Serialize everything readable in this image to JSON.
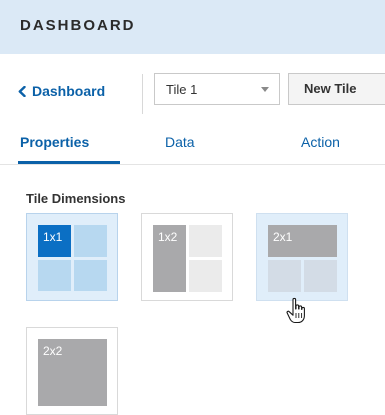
{
  "header": {
    "title": "DASHBOARD"
  },
  "nav": {
    "back_label": "Dashboard",
    "tile_select_value": "Tile 1",
    "new_tile_label": "New Tile"
  },
  "tabs": [
    {
      "label": "Properties",
      "active": true
    },
    {
      "label": "Data",
      "active": false
    },
    {
      "label": "Action",
      "active": false
    }
  ],
  "tile_dimensions": {
    "title": "Tile Dimensions",
    "options": [
      {
        "label": "1x1",
        "selected": true
      },
      {
        "label": "1x2",
        "selected": false
      },
      {
        "label": "2x1",
        "selected": false,
        "hovered": true
      },
      {
        "label": "2x2",
        "selected": false
      }
    ]
  },
  "colors": {
    "header_bg": "#dbe9f6",
    "accent": "#0b61a8",
    "tile_selected": "#0b6fc4",
    "tile_light_blue": "#b7d8f0",
    "tile_gray": "#a9a9ab",
    "tile_light_gray": "#ebebeb"
  },
  "icons": {
    "back": "chevron-left-icon",
    "dropdown": "caret-down-icon",
    "cursor": "hand-pointer-icon"
  }
}
